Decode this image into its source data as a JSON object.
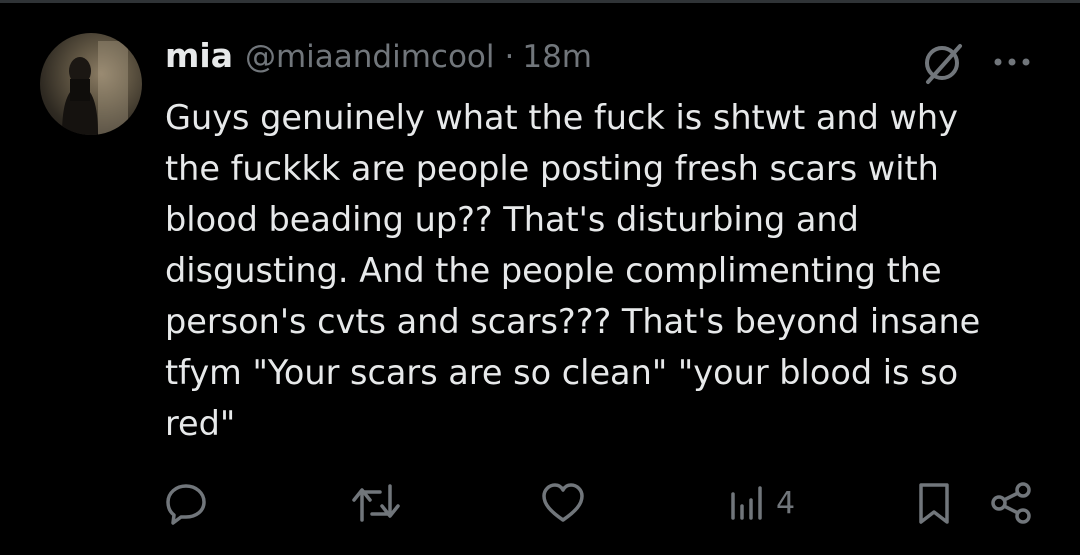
{
  "tweet": {
    "display_name": "mia",
    "handle": "@miaandimcool",
    "separator": "·",
    "timestamp": "18m",
    "text": "Guys genuinely what the fuck is shtwt and why\nthe fuckkk are people posting fresh scars with\nblood beading up?? That's disturbing and\ndisgusting. And the people complimenting the\nperson's cvts and scars??? That's beyond insane\ntfym \"Your scars are so clean\" \"your blood is so\nred\""
  },
  "header_icons": {
    "grok": "grok-icon",
    "more": "more-icon"
  },
  "actions": {
    "reply": {
      "icon": "reply-icon",
      "count": ""
    },
    "repost": {
      "icon": "repost-icon",
      "count": ""
    },
    "like": {
      "icon": "like-icon",
      "count": ""
    },
    "views": {
      "icon": "views-icon",
      "count": "4"
    },
    "bookmark": {
      "icon": "bookmark-icon"
    },
    "share": {
      "icon": "share-icon"
    }
  },
  "colors": {
    "background": "#000000",
    "primary_text": "#e7e9ea",
    "secondary_text": "#71767b",
    "divider": "#2f3336"
  }
}
